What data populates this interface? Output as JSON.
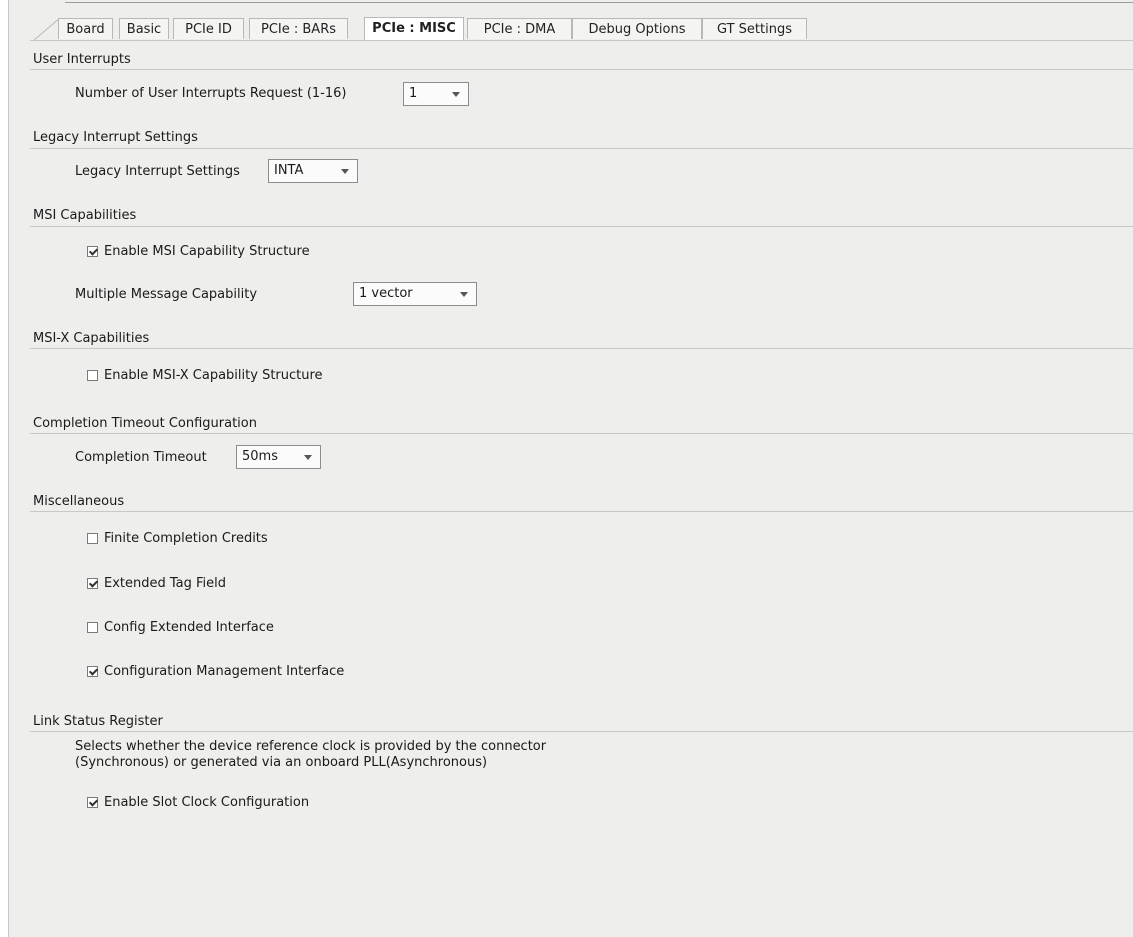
{
  "tabs": [
    "Board",
    "Basic",
    "PCIe ID",
    "PCIe : BARs",
    "PCIe : MISC",
    "PCIe : DMA",
    "Debug Options",
    "GT Settings"
  ],
  "active_tab": "PCIe : MISC",
  "user_interrupts": {
    "title": "User Interrupts",
    "label": "Number of User Interrupts Request (1-16)",
    "value": "1"
  },
  "legacy": {
    "title": "Legacy Interrupt Settings",
    "label": "Legacy Interrupt Settings",
    "value": "INTA"
  },
  "msi": {
    "title": "MSI Capabilities",
    "enable_label": "Enable MSI Capability Structure",
    "enable_checked": true,
    "mmc_label": "Multiple Message Capability",
    "mmc_value": "1 vector"
  },
  "msix": {
    "title": "MSI-X Capabilities",
    "enable_label": "Enable MSI-X Capability Structure",
    "enable_checked": false
  },
  "completion": {
    "title": "Completion Timeout Configuration",
    "label": "Completion Timeout",
    "value": "50ms"
  },
  "misc": {
    "title": "Miscellaneous",
    "items": [
      {
        "label": "Finite Completion Credits",
        "checked": false
      },
      {
        "label": "Extended Tag Field",
        "checked": true
      },
      {
        "label": "Config Extended Interface",
        "checked": false
      },
      {
        "label": "Configuration Management Interface",
        "checked": true
      }
    ]
  },
  "link_status": {
    "title": "Link Status Register",
    "desc_line1": "Selects whether the device reference clock is provided by the connector",
    "desc_line2": "(Synchronous) or generated via an onboard PLL(Asynchronous)",
    "slot_clock_label": "Enable Slot Clock Configuration",
    "slot_clock_checked": true
  }
}
